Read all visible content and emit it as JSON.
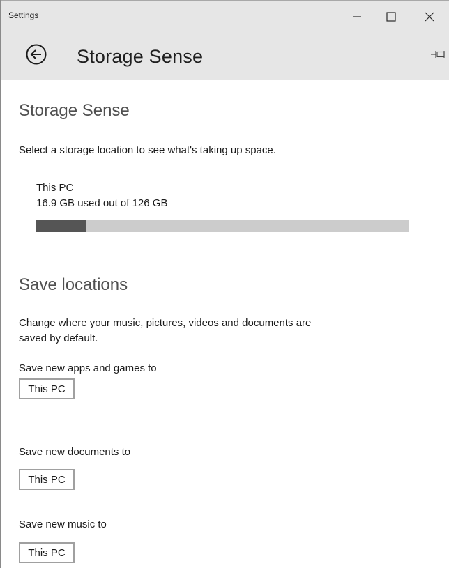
{
  "window": {
    "title": "Settings",
    "controls": [
      "minimize",
      "maximize",
      "close"
    ]
  },
  "header": {
    "title": "Storage Sense",
    "back_icon": "back-arrow-icon",
    "pin_icon": "pin-icon"
  },
  "storage": {
    "heading": "Storage Sense",
    "description": "Select a storage location to see what's taking up space.",
    "drive": {
      "name": "This PC",
      "usage_text": "16.9 GB used out of 126 GB",
      "used_fraction": 0.134
    }
  },
  "save_locations": {
    "heading": "Save locations",
    "description_line1": "Change where your music, pictures, videos and documents are",
    "description_line2": "saved by default.",
    "items": [
      {
        "label": "Save new apps and games to",
        "value": "This PC"
      },
      {
        "label": "Save new documents to",
        "value": "This PC"
      },
      {
        "label": "Save new music to",
        "value": "This PC"
      }
    ]
  },
  "colors": {
    "titlebar_bg": "#e6e6e6",
    "bar_used": "#555555",
    "bar_free": "#cccccc"
  }
}
